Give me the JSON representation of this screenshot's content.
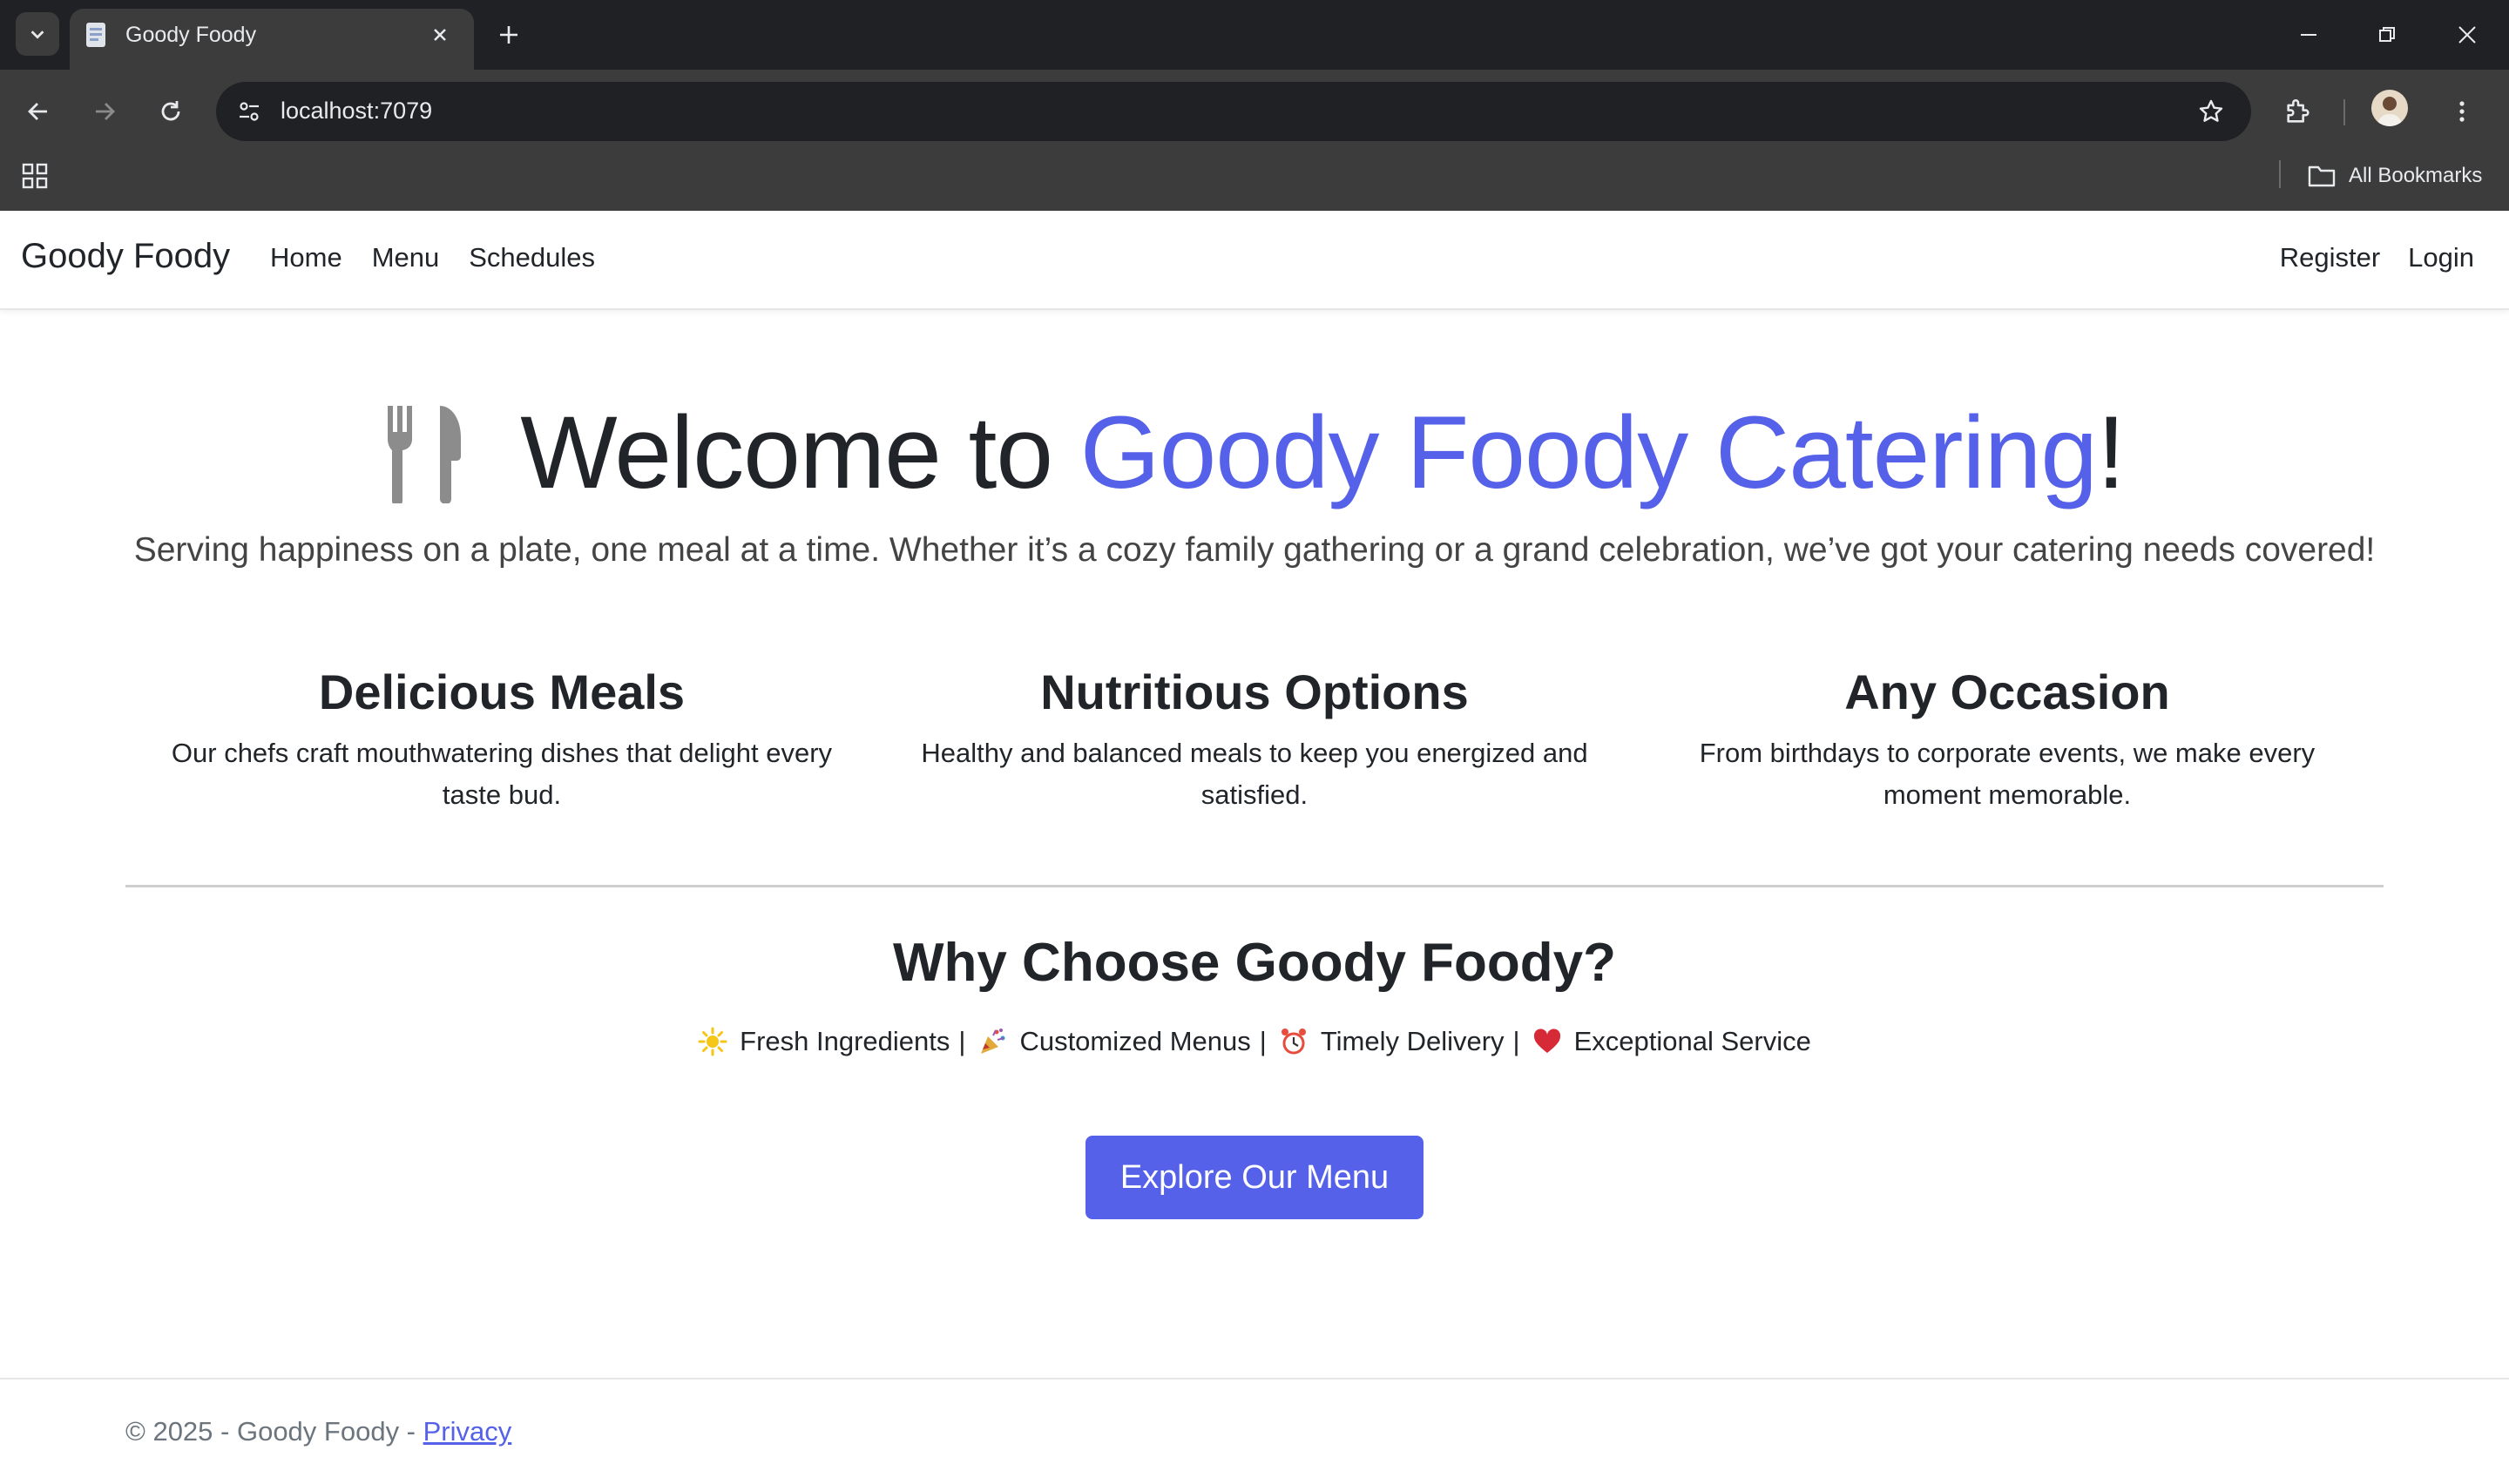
{
  "browser": {
    "tab_title": "Goody Foody",
    "url": "localhost:7079",
    "bookmarks_label": "All Bookmarks"
  },
  "navbar": {
    "brand": "Goody Foody",
    "links": [
      "Home",
      "Menu",
      "Schedules"
    ],
    "right_links": [
      "Register",
      "Login"
    ]
  },
  "hero": {
    "title_prefix": "Welcome to ",
    "title_accent": "Goody Foody Catering",
    "title_suffix": "!",
    "subtitle": "Serving happiness on a plate, one meal at a time. Whether it’s a cozy family gathering or a grand celebration, we’ve got your catering needs covered!"
  },
  "features": [
    {
      "title": "Delicious Meals",
      "text": "Our chefs craft mouthwatering dishes that delight every taste bud."
    },
    {
      "title": "Nutritious Options",
      "text": "Healthy and balanced meals to keep you energized and satisfied."
    },
    {
      "title": "Any Occasion",
      "text": "From birthdays to corporate events, we make every moment memorable."
    }
  ],
  "why": {
    "title": "Why Choose Goody Foody?",
    "items": [
      {
        "icon": "sun-icon",
        "label": "Fresh Ingredients"
      },
      {
        "icon": "party-popper-icon",
        "label": "Customized Menus"
      },
      {
        "icon": "alarm-clock-icon",
        "label": "Timely Delivery"
      },
      {
        "icon": "heart-icon",
        "label": "Exceptional Service"
      }
    ],
    "separator": "|"
  },
  "cta": {
    "label": "Explore Our Menu"
  },
  "footer": {
    "copyright": "© 2025 - Goody Foody - ",
    "privacy_link": "Privacy"
  },
  "colors": {
    "accent": "#5561e8",
    "chrome_dark": "#202124",
    "chrome_toolbar": "#3c3c3c"
  }
}
